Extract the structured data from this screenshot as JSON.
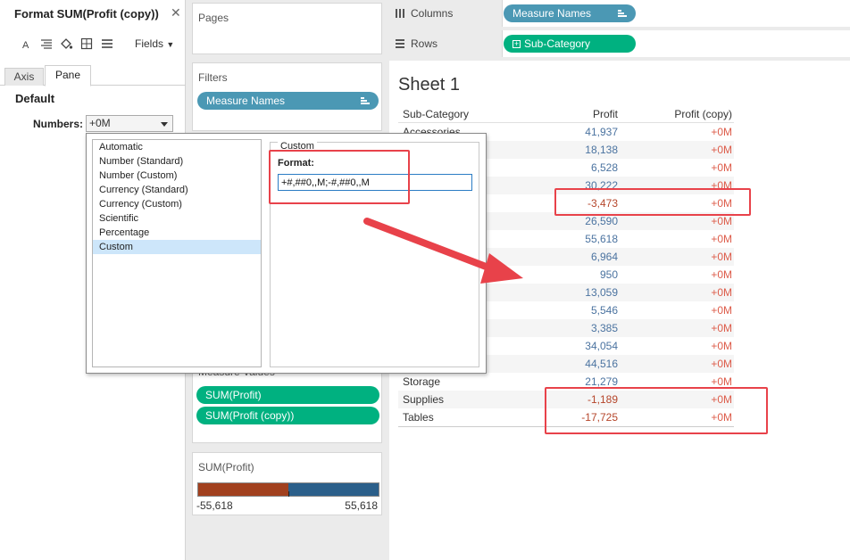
{
  "format_panel": {
    "title": "Format SUM(Profit (copy))",
    "close": "✕",
    "fields_label": "Fields",
    "tabs": [
      "Axis",
      "Pane"
    ],
    "default_heading": "Default",
    "numbers_label": "Numbers:",
    "numbers_value": "+0M"
  },
  "format_popup": {
    "options": [
      "Automatic",
      "Number (Standard)",
      "Number (Custom)",
      "Currency (Standard)",
      "Currency (Custom)",
      "Scientific",
      "Percentage",
      "Custom"
    ],
    "selected": "Custom",
    "custom_legend": "Custom",
    "format_label": "Format:",
    "format_value": "+#,##0,,M;-#,##0,,M"
  },
  "shelves": {
    "pages_title": "Pages",
    "filters_title": "Filters",
    "filters_pill": "Measure Names",
    "measure_values_title": "Measure Values",
    "measure_pills": [
      "SUM(Profit)",
      "SUM(Profit (copy))"
    ],
    "columns_label": "Columns",
    "columns_pill": "Measure Names",
    "rows_label": "Rows",
    "rows_pill": "Sub-Category"
  },
  "legend": {
    "title": "SUM(Profit)",
    "min": "-55,618",
    "max": "55,618",
    "neg_color": "#a1401e",
    "pos_color": "#2b5f8a"
  },
  "sheet": {
    "title": "Sheet 1",
    "headers": [
      "Sub-Category",
      "Profit",
      "Profit (copy)"
    ],
    "rows": [
      {
        "sub": "Accessories",
        "profit": "41,937",
        "copy": "+0M"
      },
      {
        "sub": "",
        "profit": "18,138",
        "copy": "+0M"
      },
      {
        "sub": "",
        "profit": "6,528",
        "copy": "+0M"
      },
      {
        "sub": "",
        "profit": "30,222",
        "copy": "+0M"
      },
      {
        "sub": "",
        "profit": "-3,473",
        "copy": "+0M"
      },
      {
        "sub": "",
        "profit": "26,590",
        "copy": "+0M"
      },
      {
        "sub": "",
        "profit": "55,618",
        "copy": "+0M"
      },
      {
        "sub": "",
        "profit": "6,964",
        "copy": "+0M"
      },
      {
        "sub": "",
        "profit": "950",
        "copy": "+0M"
      },
      {
        "sub": "",
        "profit": "13,059",
        "copy": "+0M"
      },
      {
        "sub": "",
        "profit": "5,546",
        "copy": "+0M"
      },
      {
        "sub": "",
        "profit": "3,385",
        "copy": "+0M"
      },
      {
        "sub": "",
        "profit": "34,054",
        "copy": "+0M"
      },
      {
        "sub": "",
        "profit": "44,516",
        "copy": "+0M"
      },
      {
        "sub": "Storage",
        "profit": "21,279",
        "copy": "+0M"
      },
      {
        "sub": "Supplies",
        "profit": "-1,189",
        "copy": "+0M"
      },
      {
        "sub": "Tables",
        "profit": "-17,725",
        "copy": "+0M"
      }
    ]
  },
  "colors": {
    "positive_text": "#4b73a0",
    "negative_text": "#b5452a",
    "copy_text": "#dd5c4a",
    "pill_blue": "#4b98b4",
    "pill_green": "#00b180",
    "highlight": "#e8424a"
  },
  "icons": [
    "font-icon",
    "align-icon",
    "shading-icon",
    "borders-icon",
    "lines-icon",
    "columns-shelf-icon",
    "rows-shelf-icon",
    "sort-icon",
    "expand-plus-icon"
  ]
}
